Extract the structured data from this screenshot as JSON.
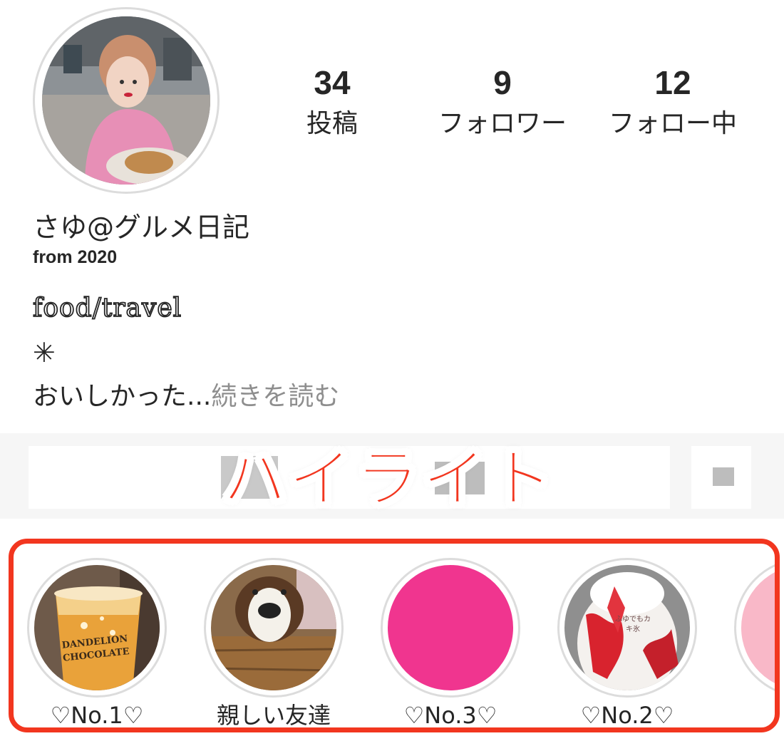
{
  "profile": {
    "avatar_icon": "profile-photo",
    "stats": {
      "posts": {
        "value": "34",
        "label": "投稿"
      },
      "followers": {
        "value": "9",
        "label": "フォロワー"
      },
      "following": {
        "value": "12",
        "label": "フォロー中"
      }
    },
    "name": "さゆ@グルメ日記",
    "subtitle": "from 2020",
    "bio_line1": "food/travel",
    "bio_line2": "✳",
    "bio_line3": "おいしかった...",
    "read_more": "続きを読む"
  },
  "overlay": {
    "title": "ハイライト",
    "accent_color": "#f2361f"
  },
  "highlights": [
    {
      "label": "♡No.1♡",
      "cover": "drink-cup-photo",
      "photo_text": "DANDELION CHOCOLATE"
    },
    {
      "label": "親しい友達",
      "cover": "dog-photo",
      "photo_text": ""
    },
    {
      "label": "♡No.3♡",
      "cover": "pink-solid",
      "color": "#f0358f"
    },
    {
      "label": "♡No.2♡",
      "cover": "shaved-ice-photo",
      "photo_text": "ふゆでもカキ氷"
    },
    {
      "label": "♡",
      "cover": "light-pink-solid",
      "color": "#f9b8c8"
    }
  ]
}
